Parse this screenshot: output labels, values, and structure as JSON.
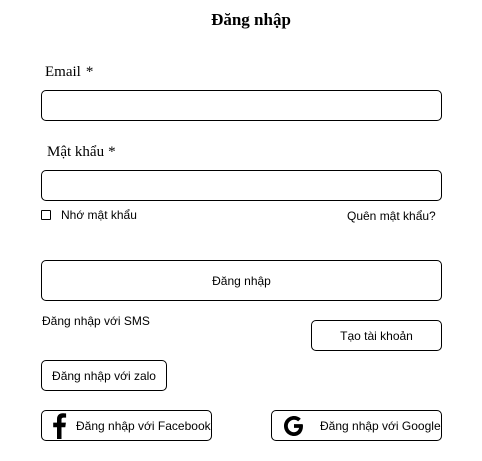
{
  "page": {
    "title": "Đăng nhập"
  },
  "form": {
    "email_label": "Email",
    "email_required": "*",
    "email_value": "",
    "password_label": "Mật khẩu",
    "password_required": "*",
    "password_value": "",
    "remember_label": "Nhớ mật khẩu",
    "remember_checked": false,
    "forgot_password_label": "Quên mật khẩu?",
    "login_button_label": "Đăng nhập"
  },
  "alt_login": {
    "sms_label": "Đăng nhập với SMS",
    "create_account_label": "Tạo tài khoản",
    "zalo_label": "Đăng nhập với zalo",
    "facebook_label": "Đăng nhập với Facebook",
    "google_label": "Đăng nhập với Google"
  },
  "icons": {
    "facebook": "facebook-icon",
    "google": "google-icon"
  }
}
